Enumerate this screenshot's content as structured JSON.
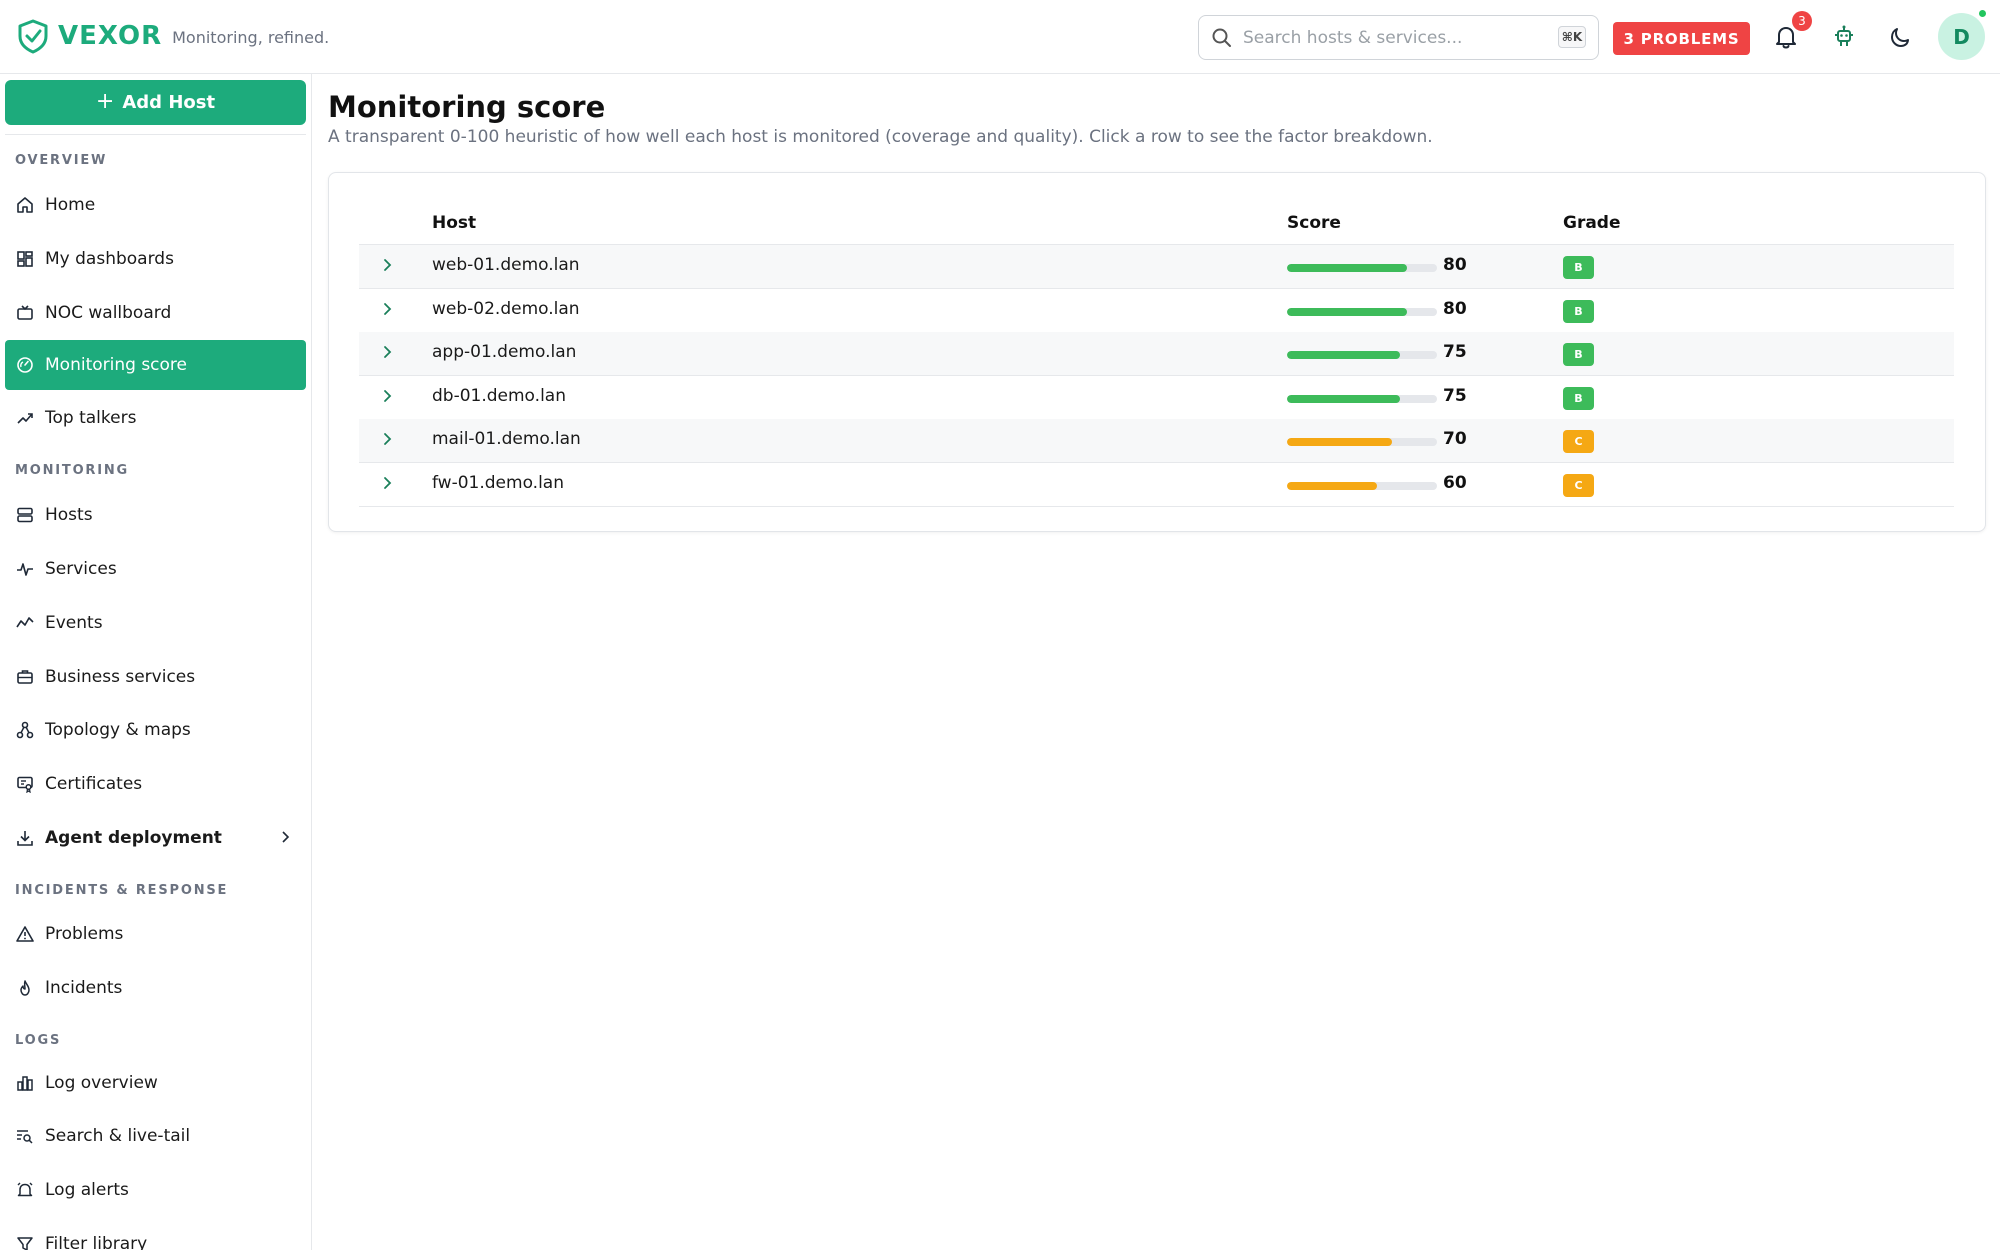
{
  "brand": {
    "name": "VEXOR",
    "tagline": "Monitoring, refined.",
    "color": "#1dab7c"
  },
  "header": {
    "search": {
      "placeholder": "Search hosts & services...",
      "shortcut": "⌘K"
    },
    "problems_label": "3 PROBLEMS",
    "notifications_count": "3",
    "avatar_initial": "D",
    "icons": [
      "bell-icon",
      "robot-icon",
      "moon-icon"
    ]
  },
  "sidebar": {
    "add_host_label": "Add Host",
    "sections": {
      "overview": "OVERVIEW",
      "monitoring": "MONITORING",
      "incidents": "INCIDENTS & RESPONSE",
      "logs": "LOGS"
    },
    "items": [
      {
        "label": "Home",
        "icon": "home-icon"
      },
      {
        "label": "My dashboards",
        "icon": "dashboard-icon"
      },
      {
        "label": "NOC wallboard",
        "icon": "tv-icon"
      },
      {
        "label": "Monitoring score",
        "icon": "gauge-icon",
        "active": true
      },
      {
        "label": "Top talkers",
        "icon": "trending-up-icon"
      },
      {
        "label": "Hosts",
        "icon": "server-icon"
      },
      {
        "label": "Services",
        "icon": "activity-icon"
      },
      {
        "label": "Events",
        "icon": "chart-line-icon"
      },
      {
        "label": "Business services",
        "icon": "briefcase-icon"
      },
      {
        "label": "Topology & maps",
        "icon": "topology-icon"
      },
      {
        "label": "Certificates",
        "icon": "certificate-icon"
      },
      {
        "label": "Agent deployment",
        "icon": "download-icon",
        "expandable": true
      },
      {
        "label": "Problems",
        "icon": "warning-icon"
      },
      {
        "label": "Incidents",
        "icon": "flame-icon"
      },
      {
        "label": "Log overview",
        "icon": "bar-chart-icon"
      },
      {
        "label": "Search & live-tail",
        "icon": "search-list-icon"
      },
      {
        "label": "Log alerts",
        "icon": "alarm-icon"
      },
      {
        "label": "Filter library",
        "icon": "filter-icon"
      }
    ]
  },
  "main": {
    "title": "Monitoring score",
    "subtitle": "A transparent 0-100 heuristic of how well each host is monitored (coverage and quality). Click a row to see the factor breakdown.",
    "table": {
      "columns": {
        "host": "Host",
        "score": "Score",
        "grade": "Grade"
      },
      "rows": [
        {
          "host": "web-01.demo.lan",
          "score": "80",
          "score_value": 80,
          "grade": "B",
          "color": "#3dbb5a"
        },
        {
          "host": "web-02.demo.lan",
          "score": "80",
          "score_value": 80,
          "grade": "B",
          "color": "#3dbb5a"
        },
        {
          "host": "app-01.demo.lan",
          "score": "75",
          "score_value": 75,
          "grade": "B",
          "color": "#3dbb5a"
        },
        {
          "host": "db-01.demo.lan",
          "score": "75",
          "score_value": 75,
          "grade": "B",
          "color": "#3dbb5a"
        },
        {
          "host": "mail-01.demo.lan",
          "score": "70",
          "score_value": 70,
          "grade": "C",
          "color": "#f5a814"
        },
        {
          "host": "fw-01.demo.lan",
          "score": "60",
          "score_value": 60,
          "grade": "C",
          "color": "#f5a814"
        }
      ]
    }
  }
}
